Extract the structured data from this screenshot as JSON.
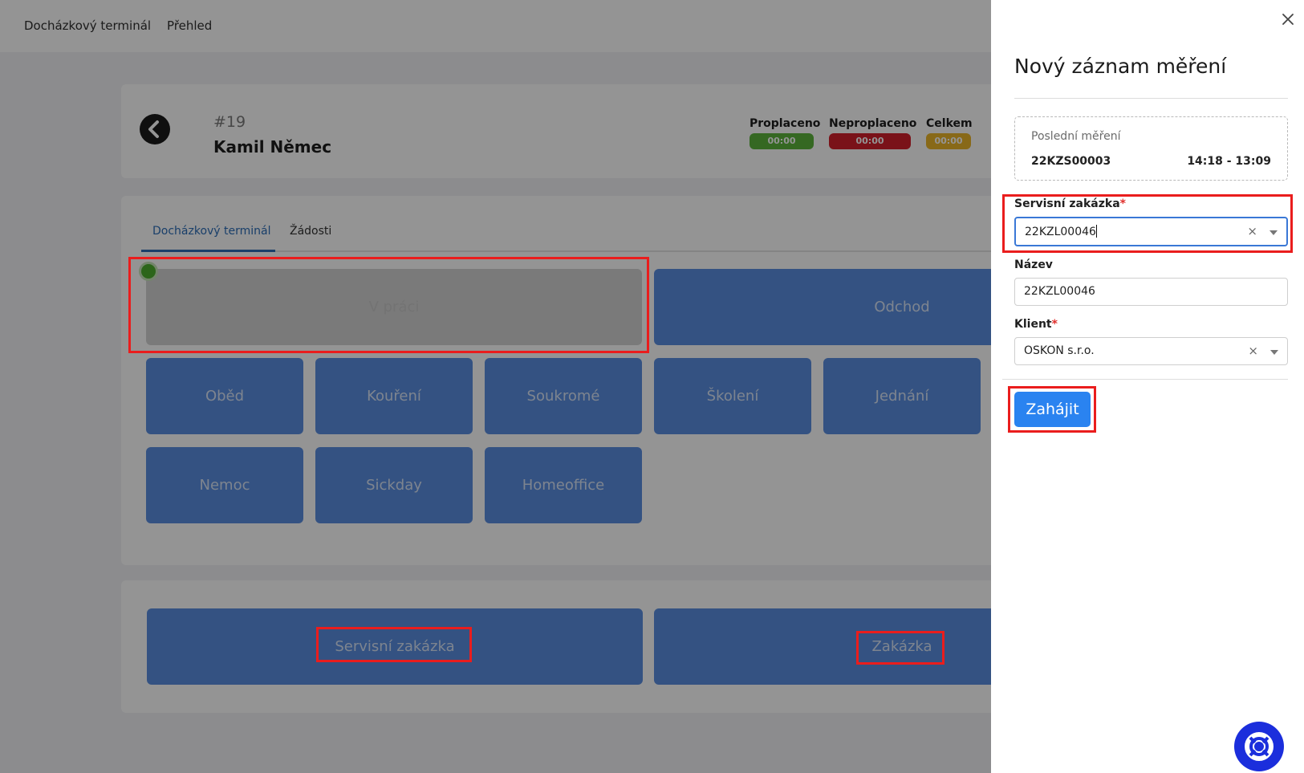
{
  "topnav": {
    "items": [
      "Docházkový terminál",
      "Přehled"
    ]
  },
  "employee": {
    "id": "#19",
    "name": "Kamil Němec"
  },
  "stats": [
    {
      "label": "Proplaceno",
      "value": "00:00",
      "color": "#5cb43b"
    },
    {
      "label": "Neproplaceno",
      "value": "00:00",
      "color": "#d21f2b"
    },
    {
      "label": "Celkem",
      "value": "00:00",
      "color": "#eab52a"
    }
  ],
  "tabs": [
    "Docházkový terminál",
    "Žádosti"
  ],
  "terminal": {
    "primary": [
      "V práci",
      "Odchod"
    ],
    "row2": [
      "Oběd",
      "Kouření",
      "Soukromé",
      "Školení",
      "Jednání"
    ],
    "row3": [
      "Nemoc",
      "Sickday",
      "Homeoffice"
    ]
  },
  "orders": [
    "Servisní zakázka",
    "Zakázka"
  ],
  "panel": {
    "title": "Nový záznam měření",
    "last": {
      "label": "Poslední měření",
      "code": "22KZS00003",
      "time": "14:18 - 13:09"
    },
    "fields": {
      "service_order": {
        "label": "Servisní zakázka",
        "required": "*",
        "value": "22KZL00046"
      },
      "name": {
        "label": "Název",
        "value": "22KZL00046"
      },
      "client": {
        "label": "Klient",
        "required": "*",
        "value": "OSKON s.r.o."
      }
    },
    "start_label": "Zahájit"
  },
  "colors": {
    "accent": "#2a83f0",
    "tile": "#5a8de0",
    "highlight": "#ea1d1d",
    "status_active": "#4caf2e"
  }
}
